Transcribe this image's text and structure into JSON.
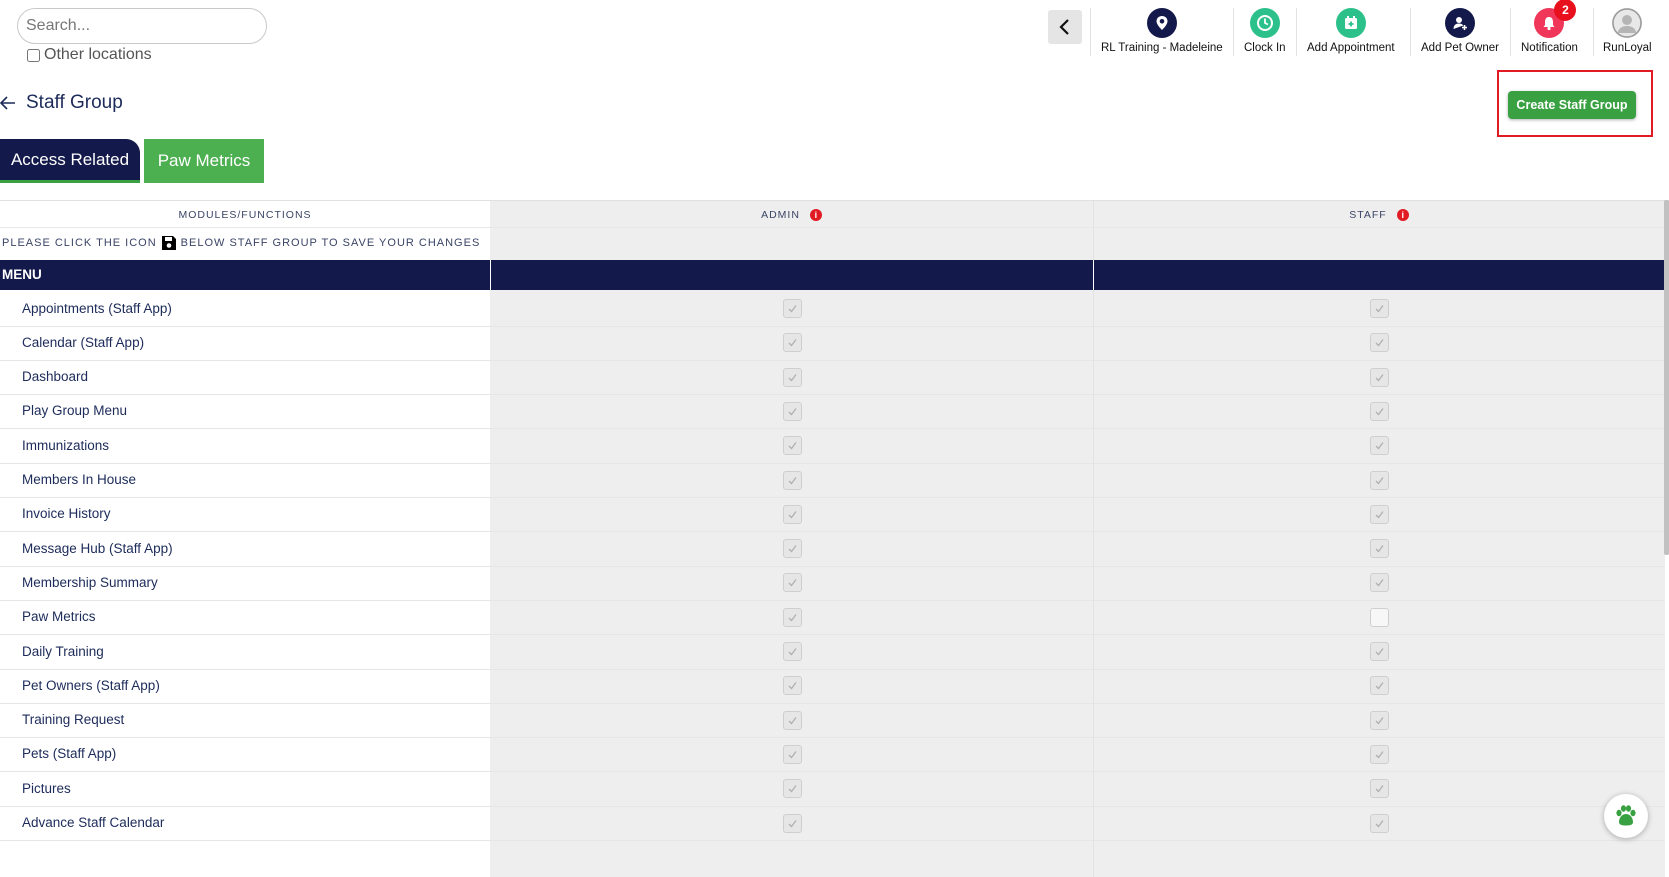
{
  "search": {
    "placeholder": "Search...",
    "other_locations_label": "Other locations"
  },
  "header": {
    "items": [
      {
        "label": "RL Training - Madeleine",
        "icon": "location-pin-icon",
        "color": "#13194a"
      },
      {
        "label": "Clock In",
        "icon": "clock-icon",
        "color": "#2cc08a"
      },
      {
        "label": "Add Appointment",
        "icon": "calendar-plus-icon",
        "color": "#2cc08a"
      },
      {
        "label": "Add Pet Owner",
        "icon": "user-plus-icon",
        "color": "#13194a"
      },
      {
        "label": "Notification",
        "icon": "bell-icon",
        "color": "#f0375a",
        "badge": "2"
      },
      {
        "label": "RunLoyal",
        "icon": "avatar-icon",
        "color": "#c9c9c9"
      }
    ]
  },
  "page": {
    "title": "Staff Group",
    "create_button": "Create Staff Group",
    "tabs": [
      "Access Related",
      "Paw Metrics"
    ]
  },
  "colors": {
    "navy": "#13194a",
    "green": "#3aa142",
    "red": "#e01b24"
  },
  "table": {
    "col_modules": "MODULES/FUNCTIONS",
    "col_admin": "ADMIN",
    "col_staff": "STAFF",
    "note_before": "PLEASE CLICK THE ICON",
    "note_after": "BELOW STAFF GROUP TO SAVE YOUR CHANGES",
    "section": "MENU",
    "rows": [
      {
        "name": "Appointments (Staff App)",
        "admin": true,
        "staff": true
      },
      {
        "name": "Calendar (Staff App)",
        "admin": true,
        "staff": true
      },
      {
        "name": "Dashboard",
        "admin": true,
        "staff": true
      },
      {
        "name": "Play Group Menu",
        "admin": true,
        "staff": true
      },
      {
        "name": "Immunizations",
        "admin": true,
        "staff": true
      },
      {
        "name": "Members In House",
        "admin": true,
        "staff": true
      },
      {
        "name": "Invoice History",
        "admin": true,
        "staff": true
      },
      {
        "name": "Message Hub (Staff App)",
        "admin": true,
        "staff": true
      },
      {
        "name": "Membership Summary",
        "admin": true,
        "staff": true
      },
      {
        "name": "Paw Metrics",
        "admin": true,
        "staff": false
      },
      {
        "name": "Daily Training",
        "admin": true,
        "staff": true
      },
      {
        "name": "Pet Owners (Staff App)",
        "admin": true,
        "staff": true
      },
      {
        "name": "Training Request",
        "admin": true,
        "staff": true
      },
      {
        "name": "Pets (Staff App)",
        "admin": true,
        "staff": true
      },
      {
        "name": "Pictures",
        "admin": true,
        "staff": true
      },
      {
        "name": "Advance Staff Calendar",
        "admin": true,
        "staff": true
      }
    ]
  }
}
